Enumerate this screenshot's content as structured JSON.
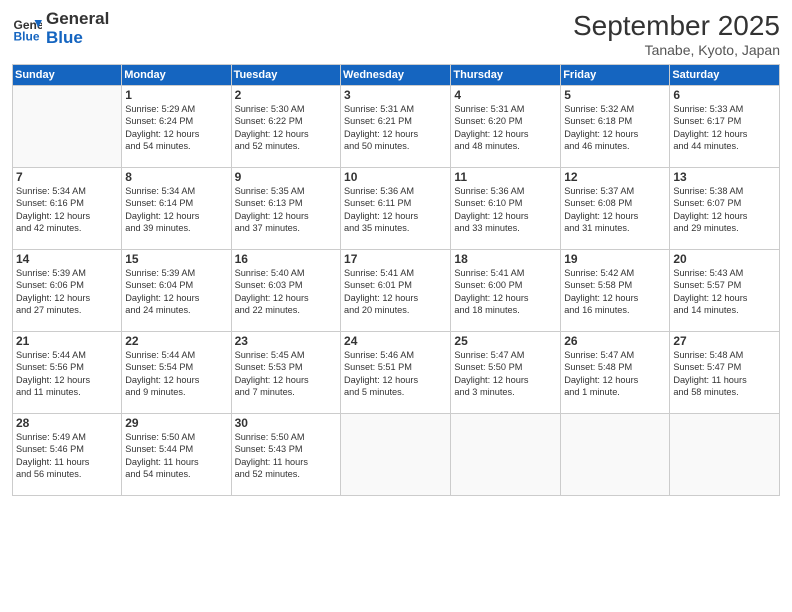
{
  "logo": {
    "line1": "General",
    "line2": "Blue"
  },
  "title": "September 2025",
  "subtitle": "Tanabe, Kyoto, Japan",
  "days_of_week": [
    "Sunday",
    "Monday",
    "Tuesday",
    "Wednesday",
    "Thursday",
    "Friday",
    "Saturday"
  ],
  "weeks": [
    [
      {
        "day": "",
        "info": ""
      },
      {
        "day": "1",
        "info": "Sunrise: 5:29 AM\nSunset: 6:24 PM\nDaylight: 12 hours\nand 54 minutes."
      },
      {
        "day": "2",
        "info": "Sunrise: 5:30 AM\nSunset: 6:22 PM\nDaylight: 12 hours\nand 52 minutes."
      },
      {
        "day": "3",
        "info": "Sunrise: 5:31 AM\nSunset: 6:21 PM\nDaylight: 12 hours\nand 50 minutes."
      },
      {
        "day": "4",
        "info": "Sunrise: 5:31 AM\nSunset: 6:20 PM\nDaylight: 12 hours\nand 48 minutes."
      },
      {
        "day": "5",
        "info": "Sunrise: 5:32 AM\nSunset: 6:18 PM\nDaylight: 12 hours\nand 46 minutes."
      },
      {
        "day": "6",
        "info": "Sunrise: 5:33 AM\nSunset: 6:17 PM\nDaylight: 12 hours\nand 44 minutes."
      }
    ],
    [
      {
        "day": "7",
        "info": "Sunrise: 5:34 AM\nSunset: 6:16 PM\nDaylight: 12 hours\nand 42 minutes."
      },
      {
        "day": "8",
        "info": "Sunrise: 5:34 AM\nSunset: 6:14 PM\nDaylight: 12 hours\nand 39 minutes."
      },
      {
        "day": "9",
        "info": "Sunrise: 5:35 AM\nSunset: 6:13 PM\nDaylight: 12 hours\nand 37 minutes."
      },
      {
        "day": "10",
        "info": "Sunrise: 5:36 AM\nSunset: 6:11 PM\nDaylight: 12 hours\nand 35 minutes."
      },
      {
        "day": "11",
        "info": "Sunrise: 5:36 AM\nSunset: 6:10 PM\nDaylight: 12 hours\nand 33 minutes."
      },
      {
        "day": "12",
        "info": "Sunrise: 5:37 AM\nSunset: 6:08 PM\nDaylight: 12 hours\nand 31 minutes."
      },
      {
        "day": "13",
        "info": "Sunrise: 5:38 AM\nSunset: 6:07 PM\nDaylight: 12 hours\nand 29 minutes."
      }
    ],
    [
      {
        "day": "14",
        "info": "Sunrise: 5:39 AM\nSunset: 6:06 PM\nDaylight: 12 hours\nand 27 minutes."
      },
      {
        "day": "15",
        "info": "Sunrise: 5:39 AM\nSunset: 6:04 PM\nDaylight: 12 hours\nand 24 minutes."
      },
      {
        "day": "16",
        "info": "Sunrise: 5:40 AM\nSunset: 6:03 PM\nDaylight: 12 hours\nand 22 minutes."
      },
      {
        "day": "17",
        "info": "Sunrise: 5:41 AM\nSunset: 6:01 PM\nDaylight: 12 hours\nand 20 minutes."
      },
      {
        "day": "18",
        "info": "Sunrise: 5:41 AM\nSunset: 6:00 PM\nDaylight: 12 hours\nand 18 minutes."
      },
      {
        "day": "19",
        "info": "Sunrise: 5:42 AM\nSunset: 5:58 PM\nDaylight: 12 hours\nand 16 minutes."
      },
      {
        "day": "20",
        "info": "Sunrise: 5:43 AM\nSunset: 5:57 PM\nDaylight: 12 hours\nand 14 minutes."
      }
    ],
    [
      {
        "day": "21",
        "info": "Sunrise: 5:44 AM\nSunset: 5:56 PM\nDaylight: 12 hours\nand 11 minutes."
      },
      {
        "day": "22",
        "info": "Sunrise: 5:44 AM\nSunset: 5:54 PM\nDaylight: 12 hours\nand 9 minutes."
      },
      {
        "day": "23",
        "info": "Sunrise: 5:45 AM\nSunset: 5:53 PM\nDaylight: 12 hours\nand 7 minutes."
      },
      {
        "day": "24",
        "info": "Sunrise: 5:46 AM\nSunset: 5:51 PM\nDaylight: 12 hours\nand 5 minutes."
      },
      {
        "day": "25",
        "info": "Sunrise: 5:47 AM\nSunset: 5:50 PM\nDaylight: 12 hours\nand 3 minutes."
      },
      {
        "day": "26",
        "info": "Sunrise: 5:47 AM\nSunset: 5:48 PM\nDaylight: 12 hours\nand 1 minute."
      },
      {
        "day": "27",
        "info": "Sunrise: 5:48 AM\nSunset: 5:47 PM\nDaylight: 11 hours\nand 58 minutes."
      }
    ],
    [
      {
        "day": "28",
        "info": "Sunrise: 5:49 AM\nSunset: 5:46 PM\nDaylight: 11 hours\nand 56 minutes."
      },
      {
        "day": "29",
        "info": "Sunrise: 5:50 AM\nSunset: 5:44 PM\nDaylight: 11 hours\nand 54 minutes."
      },
      {
        "day": "30",
        "info": "Sunrise: 5:50 AM\nSunset: 5:43 PM\nDaylight: 11 hours\nand 52 minutes."
      },
      {
        "day": "",
        "info": ""
      },
      {
        "day": "",
        "info": ""
      },
      {
        "day": "",
        "info": ""
      },
      {
        "day": "",
        "info": ""
      }
    ]
  ]
}
